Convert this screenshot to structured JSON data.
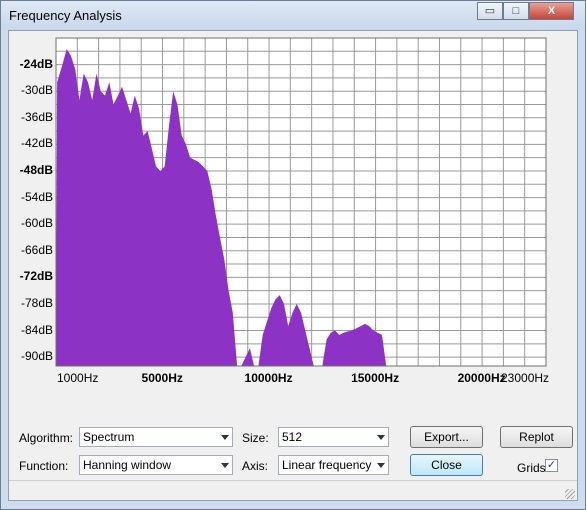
{
  "window": {
    "title": "Frequency Analysis"
  },
  "titlebar_buttons": {
    "minimize": "▭",
    "maximize": "□",
    "close": "X"
  },
  "chart_data": {
    "type": "area",
    "ylabels": [
      "-24dB",
      "-30dB",
      "-36dB",
      "-42dB",
      "-48dB",
      "-54dB",
      "-60dB",
      "-66dB",
      "-72dB",
      "-78dB",
      "-84dB",
      "-90dB"
    ],
    "yticks": [
      -24,
      -30,
      -36,
      -42,
      -48,
      -54,
      -60,
      -66,
      -72,
      -78,
      -84,
      -90
    ],
    "ylabels_bold": [
      -24,
      -48,
      -72
    ],
    "xlabels": [
      {
        "text": "1000Hz",
        "value": 1000,
        "bold": false
      },
      {
        "text": "5000Hz",
        "value": 5000,
        "bold": true
      },
      {
        "text": "10000Hz",
        "value": 10000,
        "bold": true
      },
      {
        "text": "15000Hz",
        "value": 15000,
        "bold": true
      },
      {
        "text": "20000Hz",
        "value": 20000,
        "bold": true
      },
      {
        "text": "23000Hz",
        "value": 23000,
        "bold": false
      }
    ],
    "xlim": [
      0,
      23000
    ],
    "ylim": [
      -92,
      -18
    ],
    "x_grid_step": 1000,
    "y_grid_step": 3,
    "grid": true,
    "fill_color": "#8c33c6",
    "series": [
      {
        "x": [
          0,
          50,
          300,
          500,
          700,
          900,
          1100,
          1300,
          1500,
          1700,
          1900,
          2100,
          2300,
          2500,
          2700,
          2900,
          3100,
          3300,
          3500,
          3700,
          3900,
          4100,
          4300,
          4500,
          4700,
          4900,
          5100,
          5300,
          5500,
          5700,
          5900,
          6100,
          6300,
          6500,
          6700,
          6900,
          7100,
          7300,
          7500,
          7700,
          7900,
          8100,
          8300,
          8500,
          8700,
          8900,
          9100,
          9300,
          9500,
          9700,
          9900,
          10100,
          10300,
          10500,
          10700,
          10900,
          11100,
          11300,
          11500,
          11700,
          11900,
          12100,
          12300,
          12500,
          12700,
          12900,
          13100,
          13300,
          13500,
          13700,
          13900,
          14100,
          14300,
          14500,
          14700,
          14900,
          15100,
          15300,
          15500,
          16000,
          18000,
          20000,
          23000
        ],
        "y": [
          -92,
          -28,
          -24,
          -20.5,
          -22,
          -25,
          -32,
          -26,
          -28,
          -32,
          -26,
          -30,
          -31,
          -28,
          -33,
          -31,
          -29,
          -32,
          -35,
          -31,
          -34,
          -40,
          -39,
          -43,
          -47,
          -48,
          -47,
          -38,
          -30,
          -33,
          -40,
          -42,
          -45,
          -45.5,
          -46,
          -47,
          -48,
          -52,
          -58,
          -63,
          -68,
          -75,
          -80,
          -92,
          -92,
          -90,
          -88,
          -92,
          -92,
          -85,
          -82,
          -79,
          -77,
          -76,
          -78,
          -83,
          -80,
          -78,
          -80,
          -84,
          -88,
          -92,
          -92,
          -92,
          -86,
          -84.5,
          -84,
          -85,
          -84.5,
          -84.2,
          -84,
          -83.5,
          -83,
          -82.5,
          -83,
          -84,
          -84.5,
          -85,
          -92,
          -92,
          -92,
          -92,
          -92
        ]
      }
    ]
  },
  "controls": {
    "algorithm_label": "Algorithm:",
    "algorithm_value": "Spectrum",
    "size_label": "Size:",
    "size_value": "512",
    "export_button": "Export...",
    "replot_button": "Replot",
    "function_label": "Function:",
    "function_value": "Hanning window",
    "axis_label": "Axis:",
    "axis_value": "Linear frequency",
    "close_button": "Close",
    "grids_label": "Grids",
    "grids_checked": true,
    "grids_check_glyph": "✓"
  }
}
